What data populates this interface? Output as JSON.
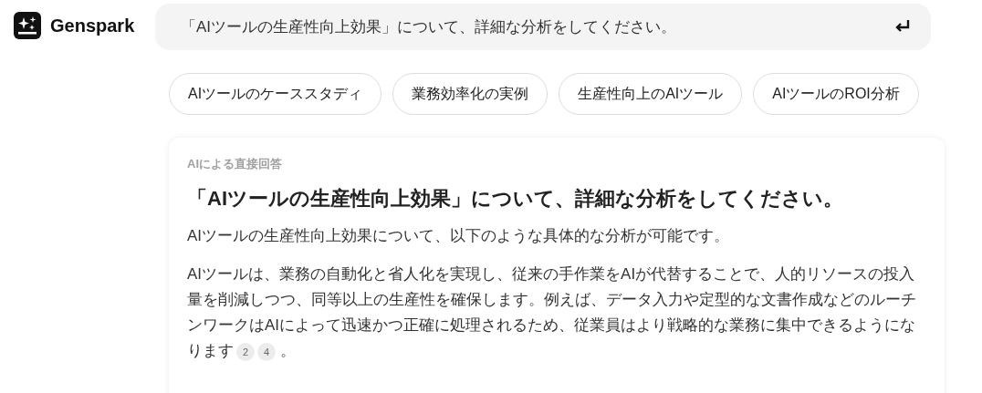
{
  "brand": {
    "name": "Genspark"
  },
  "search": {
    "value": "「AIツールの生産性向上効果」について、詳細な分析をしてください。"
  },
  "suggestions": [
    "AIツールのケーススタディ",
    "業務効率化の実例",
    "生産性向上のAIツール",
    "AIツールのROI分析"
  ],
  "answer": {
    "label": "AIによる直接回答",
    "title": "「AIツールの生産性向上効果」について、詳細な分析をしてください。",
    "paragraphs": [
      {
        "text": "AIツールの生産性向上効果について、以下のような具体的な分析が可能です。"
      },
      {
        "text": "AIツールは、業務の自動化と省人化を実現し、従来の手作業をAIが代替することで、人的リソースの投入量を削減しつつ、同等以上の生産性を確保します。例えば、データ入力や定型的な文書作成などのルーチンワークはAIによって迅速かつ正確に処理されるため、従業員はより戦略的な業務に集中できるようになります",
        "citations": [
          "2",
          "4"
        ],
        "end": "。"
      }
    ]
  }
}
